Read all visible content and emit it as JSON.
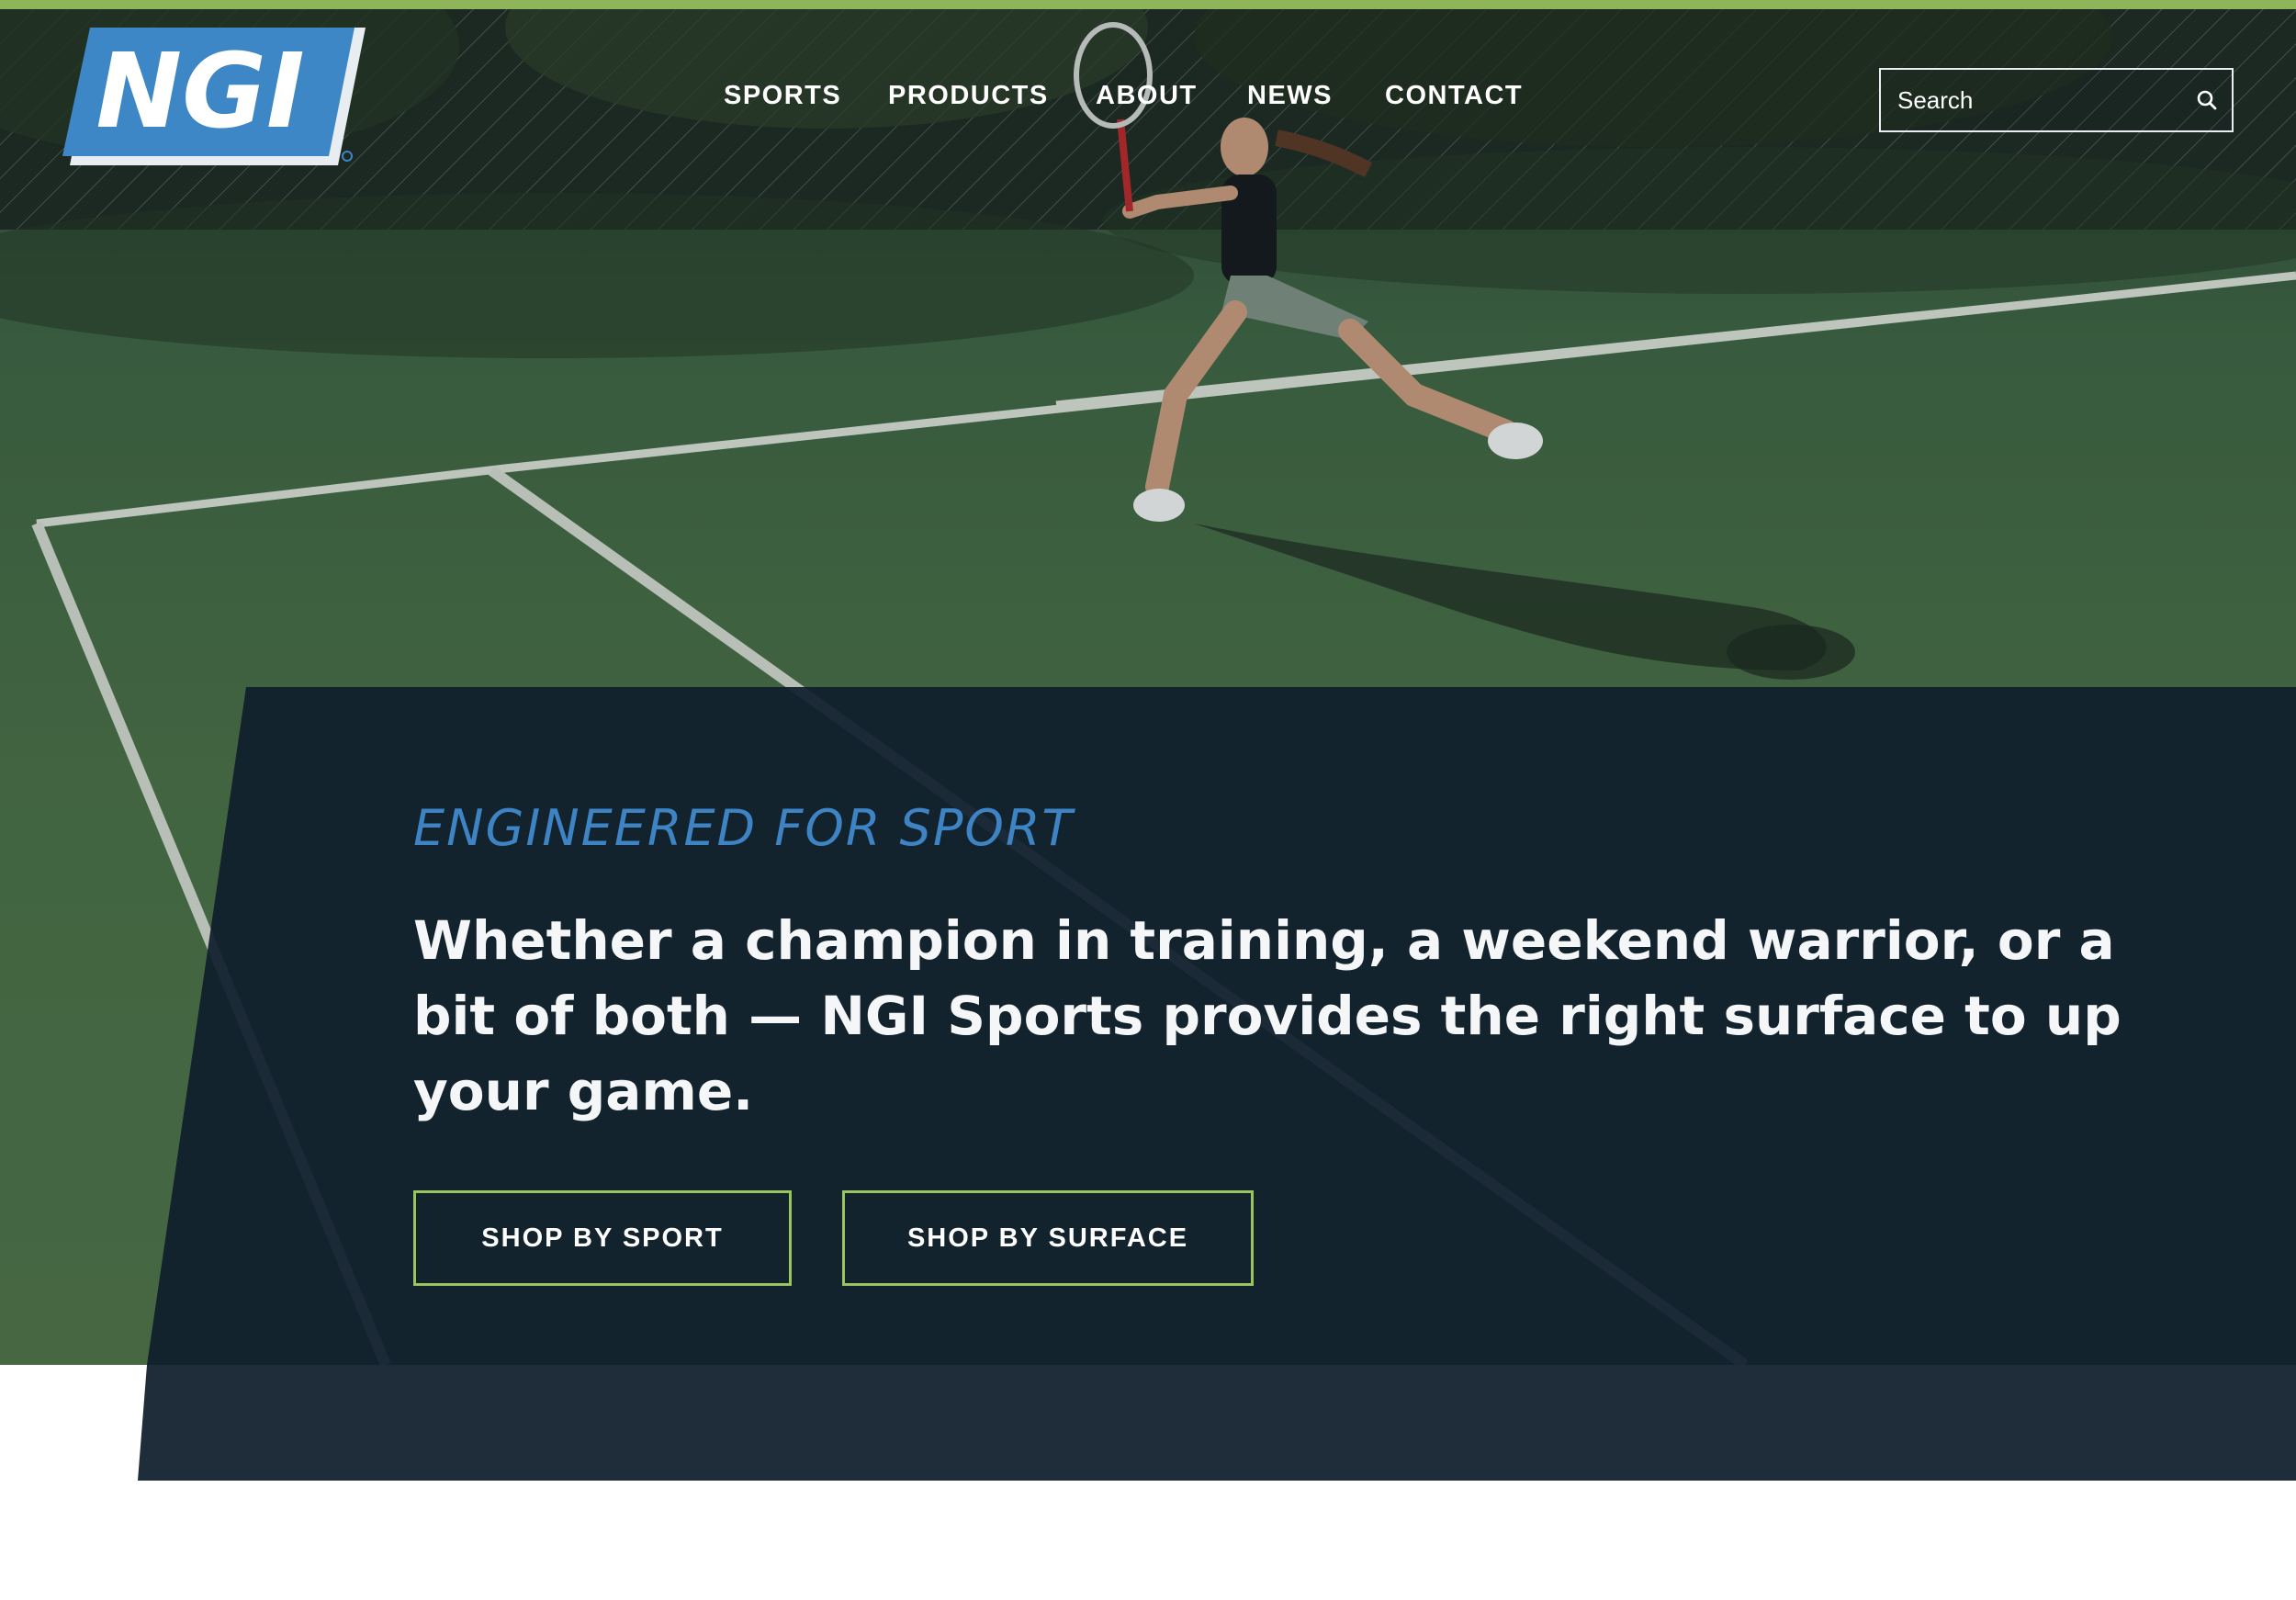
{
  "brand": {
    "name": "NGI",
    "accent": "#8fb55a",
    "blue": "#3e84c5",
    "navy": "#111f2d"
  },
  "nav": {
    "items": [
      {
        "label": "SPORTS"
      },
      {
        "label": "PRODUCTS"
      },
      {
        "label": "ABOUT"
      },
      {
        "label": "NEWS"
      },
      {
        "label": "CONTACT"
      }
    ]
  },
  "search": {
    "placeholder": "Search",
    "icon": "search-icon"
  },
  "hero": {
    "eyebrow": "ENGINEERED FOR SPORT",
    "headline": "Whether a champion in training, a weekend warrior, or a bit of both — NGI Sports provides the right surface to up your game.",
    "buttons": [
      {
        "label": "SHOP BY SPORT"
      },
      {
        "label": "SHOP BY SURFACE"
      }
    ]
  }
}
